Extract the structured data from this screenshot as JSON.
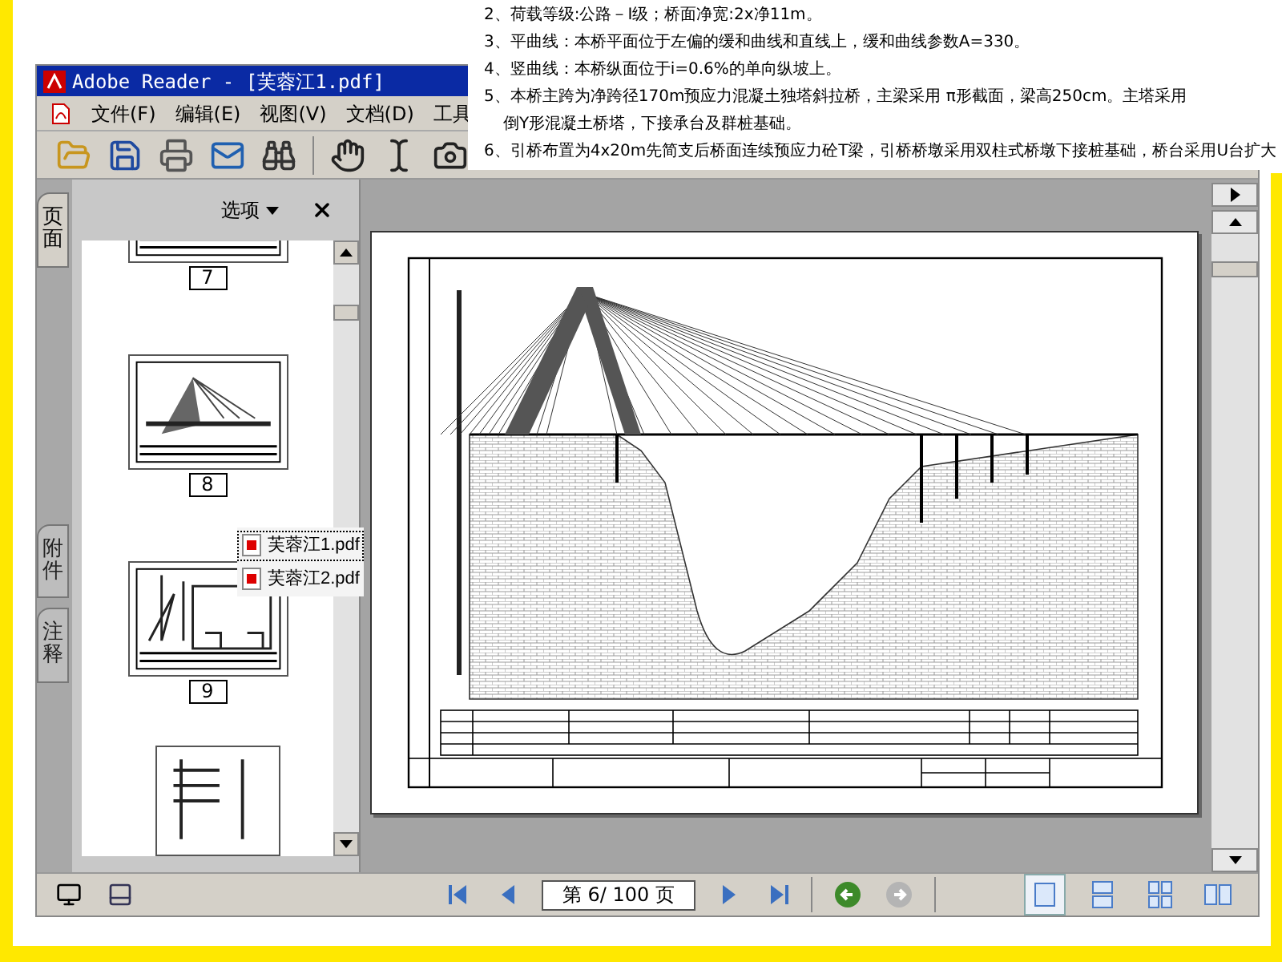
{
  "notes": [
    {
      "lines": [
        "2、荷载等级:公路－Ⅰ级；桥面净宽:2x净11m。"
      ]
    },
    {
      "lines": [
        "3、平曲线：本桥平面位于左偏的缓和曲线和直线上，缓和曲线参数A=330。"
      ]
    },
    {
      "lines": [
        "4、竖曲线：本桥纵面位于i=0.6%的单向纵坡上。"
      ]
    },
    {
      "lines": [
        "5、本桥主跨为净跨径170m预应力混凝土独塔斜拉桥，主梁采用 π形截面，梁高250cm。主塔采用",
        "倒Y形混凝土桥塔，下接承台及群桩基础。"
      ]
    },
    {
      "lines": [
        "6、引桥布置为4x20m先简支后桥面连续预应力砼T梁，引桥桥墩采用双柱式桥墩下接桩基础，桥台采用U台扩大"
      ]
    }
  ],
  "window": {
    "title": "Adobe Reader - [芙蓉江1.pdf]"
  },
  "menu": [
    "文件(F)",
    "编辑(E)",
    "视图(V)",
    "文档(D)",
    "工具"
  ],
  "side_panel": {
    "tabs": [
      {
        "label": "页面",
        "selected": true
      },
      {
        "label": "附件",
        "selected": false
      },
      {
        "label": "注释",
        "selected": false
      }
    ],
    "options": "选项",
    "thumbnails": [
      {
        "label": "7",
        "kind": "cropped"
      },
      {
        "label": "8",
        "kind": "bridge"
      },
      {
        "label": "9",
        "kind": "pier"
      }
    ]
  },
  "file_list": [
    {
      "name": "芙蓉江1.pdf",
      "selected": true
    },
    {
      "name": "芙蓉江2.pdf",
      "selected": false
    }
  ],
  "page_field": {
    "value": "第 6/ 100 页"
  },
  "history_buttons": [
    {
      "kind": "back",
      "disabled": false
    },
    {
      "kind": "forward",
      "disabled": true
    }
  ],
  "view_modes": [
    {
      "kind": "single",
      "selected": true
    },
    {
      "kind": "continuous",
      "selected": false
    },
    {
      "kind": "continuous_facing",
      "selected": false
    },
    {
      "kind": "facing",
      "selected": false
    }
  ]
}
